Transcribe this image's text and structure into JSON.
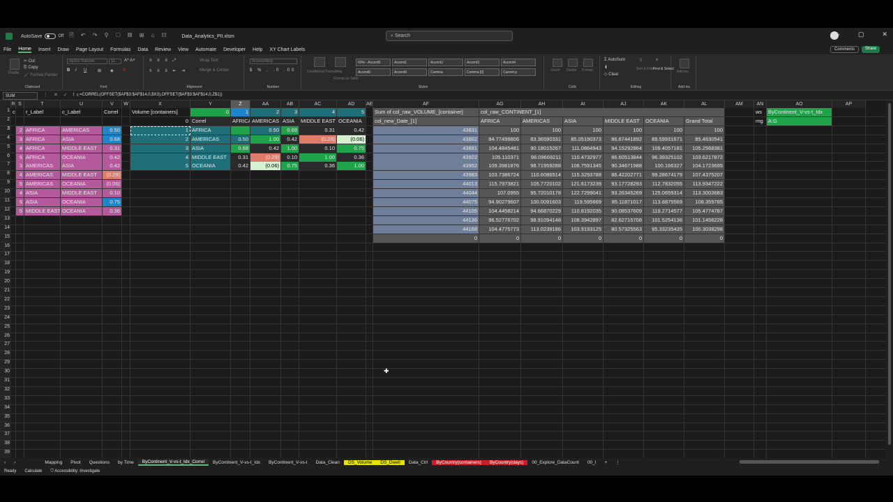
{
  "window": {
    "autosave_label": "AutoSave",
    "autosave_state": "Off",
    "filename": "Data_Analytics_PII.xlsm",
    "search_placeholder": "Search"
  },
  "menu": [
    "File",
    "Home",
    "Insert",
    "Draw",
    "Page Layout",
    "Formulas",
    "Data",
    "Review",
    "View",
    "Automate",
    "Developer",
    "Help",
    "XY Chart Labels"
  ],
  "menu_active": "Home",
  "menu_right": {
    "comments": "Comments",
    "share": "Share"
  },
  "ribbon": {
    "clipboard": {
      "label": "Clipboard",
      "paste": "Paste",
      "cut": "Cut",
      "copy": "Copy",
      "format_painter": "Format Painter"
    },
    "font": {
      "label": "Font",
      "font_name": "Aptos Narrow",
      "font_size": "11"
    },
    "alignment": {
      "label": "Alignment",
      "wrap": "Wrap Text",
      "merge": "Merge & Center"
    },
    "number": {
      "label": "Number",
      "format": "Accounting"
    },
    "styles": {
      "label": "Styles",
      "cond": "Conditional Formatting",
      "table": "Format as Table",
      "cells": [
        "60% - Accent6",
        "Accent1",
        "Accent2",
        "Accent3",
        "Accent4",
        "Accent5",
        "Accent6",
        "Comma",
        "Comma [0]",
        "Currency"
      ]
    },
    "cells": {
      "label": "Cells",
      "insert": "Insert",
      "delete": "Delete",
      "format": "Format"
    },
    "editing": {
      "label": "Editing",
      "autosum": "AutoSum",
      "clear": "Clear",
      "sort": "Sort & Filter",
      "find": "Find & Select"
    },
    "addins": {
      "label": "Add-ins",
      "addins": "Add-ins"
    }
  },
  "formula_bar": {
    "namebox": "SUM",
    "formula": "=CORREL(OFFSET($AF$3:$AF$14,0,$X3),OFFSET($AF$3:$AF$14,0,Z$1))"
  },
  "columns": [
    "R",
    "S",
    "T",
    "U",
    "V",
    "W",
    "X",
    "Y",
    "Z",
    "AA",
    "AB",
    "AC",
    "AD",
    "AE",
    "AF",
    "AG",
    "AH",
    "AI",
    "AJ",
    "AK",
    "AL",
    "AM",
    "AN",
    "AO",
    "AP"
  ],
  "rows": [
    "1",
    "2",
    "3",
    "4",
    "5",
    "6",
    "7",
    "8",
    "9",
    "10",
    "11",
    "12",
    "13",
    "14",
    "15",
    "16",
    "17",
    "18",
    "19",
    "20",
    "21",
    "22",
    "23",
    "24",
    "25",
    "26",
    "27",
    "28",
    "29",
    "30",
    "31",
    "32",
    "33",
    "34",
    "35",
    "36",
    "37",
    "38",
    "39"
  ],
  "left_table": {
    "headers": [
      "col",
      "r_Label",
      "c_Label",
      "Correl"
    ],
    "rows": [
      [
        "2",
        "AFRICA",
        "AMERICAS",
        "0.50"
      ],
      [
        "3",
        "AFRICA",
        "ASIA",
        "0.68"
      ],
      [
        "4",
        "AFRICA",
        "MIDDLE EAST",
        "0.31"
      ],
      [
        "5",
        "AFRICA",
        "OCEANIA",
        "0.42"
      ],
      [
        "3",
        "AMERICAS",
        "ASIA",
        "0.42"
      ],
      [
        "4",
        "AMERICAS",
        "MIDDLE EAST",
        "(0.29)"
      ],
      [
        "5",
        "AMERICAS",
        "OCEANIA",
        "(0.06)"
      ],
      [
        "4",
        "ASIA",
        "MIDDLE EAST",
        "0.10"
      ],
      [
        "5",
        "ASIA",
        "OCEANIA",
        "0.75"
      ],
      [
        "5",
        "MIDDLE EAST",
        "OCEANIA",
        "0.36"
      ]
    ]
  },
  "matrix": {
    "title": "Volume [containers]",
    "idx_row": [
      "0",
      "1",
      "2",
      "3",
      "4",
      "5"
    ],
    "header_label": "Correl",
    "col_labels": [
      "AFRICA",
      "AMERICAS",
      "ASIA",
      "MIDDLE EAST",
      "OCEANIA"
    ],
    "rows": [
      {
        "idx": "1",
        "label": "AFRICA",
        "vals": [
          "",
          "0.50",
          "0.68",
          "0.31",
          "0.42"
        ]
      },
      {
        "idx": "2",
        "label": "AMERICAS",
        "vals": [
          "0.50",
          "1.00",
          "0.42",
          "(0.29)",
          "(0.06)"
        ]
      },
      {
        "idx": "3",
        "label": "ASIA",
        "vals": [
          "0.68",
          "0.42",
          "1.00",
          "0.10",
          "0.75"
        ]
      },
      {
        "idx": "4",
        "label": "MIDDLE EAST",
        "vals": [
          "0.31",
          "(0.29)",
          "0.10",
          "1.00",
          "0.36"
        ]
      },
      {
        "idx": "5",
        "label": "OCEANIA",
        "vals": [
          "0.42",
          "(0.06)",
          "0.75",
          "0.36",
          "1.00"
        ]
      }
    ]
  },
  "pivot": {
    "corner": "Sum of col_raw_VOLUME_[container]",
    "col_field": "col_raw_CONTINENT_[1]",
    "row_field": "col_new_Date_[1]",
    "headers": [
      "AFRICA",
      "AMERICAS",
      "ASIA",
      "MIDDLE EAST",
      "OCEANIA",
      "Grand Total"
    ],
    "rows": [
      {
        "date": "43831",
        "vals": [
          "100",
          "100",
          "100",
          "100",
          "100",
          "100"
        ]
      },
      {
        "date": "43862",
        "vals": [
          "84.77499806",
          "83.36590331",
          "85.05190373",
          "86.87441892",
          "89.59931671",
          "85.4630541"
        ]
      },
      {
        "date": "43891",
        "vals": [
          "104.4845481",
          "90.18015267",
          "111.0864943",
          "94.15292864",
          "109.4057181",
          "105.2568381"
        ]
      },
      {
        "date": "43922",
        "vals": [
          "105.110371",
          "98.09669211",
          "110.4732977",
          "86.60513844",
          "96.39325102",
          "103.6217872"
        ]
      },
      {
        "date": "43952",
        "vals": [
          "109.3981876",
          "98.71959288",
          "108.7591345",
          "90.34671988",
          "100.166327",
          "104.1723695"
        ]
      },
      {
        "date": "43983",
        "vals": [
          "103.7386724",
          "110.6086514",
          "115.3293788",
          "86.42202771",
          "99.28674179",
          "107.4375207"
        ]
      },
      {
        "date": "44013",
        "vals": [
          "115.7973821",
          "105.7720102",
          "121.6173239",
          "93.17728293",
          "112.7832055",
          "113.9347222"
        ]
      },
      {
        "date": "44044",
        "vals": [
          "107.0955",
          "95.72010178",
          "122.7299041",
          "93.26345269",
          "125.0659314",
          "113.3003683"
        ]
      },
      {
        "date": "44075",
        "vals": [
          "94.90279607",
          "100.0091603",
          "119.595669",
          "85.11871017",
          "113.8875569",
          "108.359785"
        ]
      },
      {
        "date": "44105",
        "vals": [
          "104.4458214",
          "94.66870229",
          "110.8192035",
          "90.08537609",
          "119.2714577",
          "105.4774787"
        ]
      },
      {
        "date": "44136",
        "vals": [
          "96.52776702",
          "98.91094148",
          "108.3942897",
          "82.62715708",
          "101.5254136",
          "101.1456228"
        ]
      },
      {
        "date": "44166",
        "vals": [
          "104.4775773",
          "113.0239186",
          "103.9193125",
          "80.57325563",
          "95.33235435",
          "100.3038298"
        ]
      },
      {
        "date": "0",
        "vals": [
          "0",
          "0",
          "0",
          "0",
          "0",
          "0"
        ]
      }
    ]
  },
  "side_box": {
    "ws_label": "ws",
    "ws_value": "ByContinent_V-vs-t_Idx",
    "rng_label": "rng",
    "rng_value": "A:G"
  },
  "sheet_tabs": [
    {
      "name": "Mapping",
      "style": "normal"
    },
    {
      "name": "Pivot",
      "style": "normal"
    },
    {
      "name": "Questions",
      "style": "normal"
    },
    {
      "name": "by Time",
      "style": "normal"
    },
    {
      "name": "ByContinent_V-vs-t_Idx_Correl",
      "style": "active"
    },
    {
      "name": "ByContinent_V-vs-t_Idx",
      "style": "normal"
    },
    {
      "name": "ByContinent_V-vs-t",
      "style": "normal"
    },
    {
      "name": "Data_Clean",
      "style": "normal"
    },
    {
      "name": "DS_Volume",
      "style": "yellow"
    },
    {
      "name": "DS_Dwell",
      "style": "yellow"
    },
    {
      "name": "Data_Ctrl",
      "style": "normal"
    },
    {
      "name": "ByCountry(containers)",
      "style": "red"
    },
    {
      "name": "ByCountry(days)",
      "style": "red"
    },
    {
      "name": "00_Explore_DataCount",
      "style": "normal"
    },
    {
      "name": "00_I",
      "style": "normal"
    }
  ],
  "status": {
    "ready": "Ready",
    "calculate": "Calculate",
    "accessibility": "Accessibility: Investigate"
  }
}
